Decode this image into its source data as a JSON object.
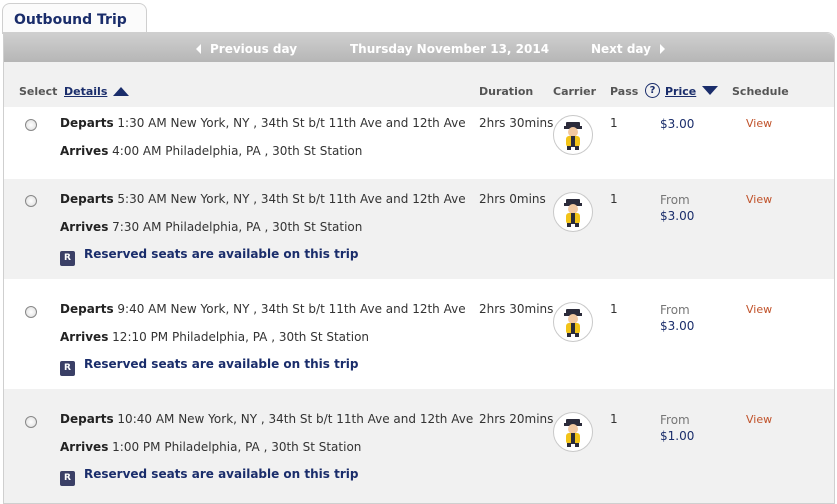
{
  "tab": {
    "title": "Outbound Trip"
  },
  "nav": {
    "prev_label": "Previous day",
    "date": "Thursday November 13, 2014",
    "next_label": "Next day"
  },
  "headers": {
    "select": "Select",
    "details": "Details",
    "duration": "Duration",
    "carrier": "Carrier",
    "pass": "Pass",
    "help": "?",
    "price": "Price",
    "schedule": "Schedule"
  },
  "reserved_badge": "R",
  "trips": [
    {
      "depart_label": "Departs",
      "depart": "1:30 AM New York, NY , 34th St b/t 11th Ave and 12th Ave",
      "arrive_label": "Arrives",
      "arrive": "4:00 AM Philadelphia, PA , 30th St Station",
      "reserved": "",
      "duration": "2hrs 30mins",
      "pass": "1",
      "price_from": "",
      "price": "$3.00",
      "view": "View"
    },
    {
      "depart_label": "Departs",
      "depart": "5:30 AM New York, NY , 34th St b/t 11th Ave and 12th Ave",
      "arrive_label": "Arrives",
      "arrive": "7:30 AM Philadelphia, PA , 30th St Station",
      "reserved": "Reserved seats are available on this trip",
      "duration": "2hrs 0mins",
      "pass": "1",
      "price_from": "From",
      "price": "$3.00",
      "view": "View"
    },
    {
      "depart_label": "Departs",
      "depart": "9:40 AM New York, NY , 34th St b/t 11th Ave and 12th Ave",
      "arrive_label": "Arrives",
      "arrive": "12:10 PM Philadelphia, PA , 30th St Station",
      "reserved": "Reserved seats are available on this trip",
      "duration": "2hrs 30mins",
      "pass": "1",
      "price_from": "From",
      "price": "$3.00",
      "view": "View"
    },
    {
      "depart_label": "Departs",
      "depart": "10:40 AM New York, NY , 34th St b/t 11th Ave and 12th Ave",
      "arrive_label": "Arrives",
      "arrive": "1:00 PM Philadelphia, PA , 30th St Station",
      "reserved": "Reserved seats are available on this trip",
      "duration": "2hrs 20mins",
      "pass": "1",
      "price_from": "From",
      "price": "$1.00",
      "view": "View"
    }
  ],
  "icons": {
    "carrier": "bus-driver-mascot-icon",
    "prev": "triangle-left-icon",
    "next": "triangle-right-icon",
    "sort_up": "sort-ascending-icon",
    "sort_down": "sort-descending-icon",
    "help": "help-circle-icon",
    "radio": "radio-button"
  },
  "colors": {
    "brand": "#1a2d6b",
    "view_link": "#c0522a",
    "row_alt": "#f1f1f1",
    "nav_bar": "#c4c4c4"
  }
}
